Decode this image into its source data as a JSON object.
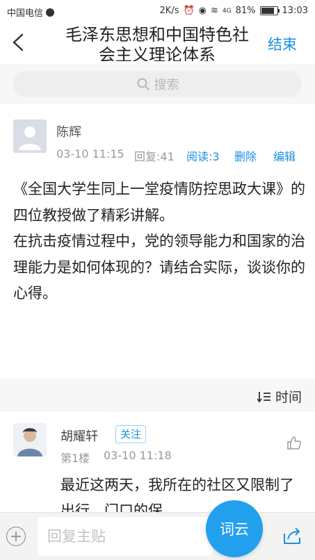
{
  "status_bar": {
    "carrier": "中国电信",
    "speed": "2K/s",
    "signal": "4G",
    "battery": "81%",
    "time": "13:03"
  },
  "header": {
    "title": "毛泽东思想和中国特色社会主义理论体系",
    "end_label": "结束"
  },
  "search": {
    "placeholder": "搜索"
  },
  "post": {
    "author": "陈辉",
    "time": "03-10 11:15",
    "replies": "回复:41",
    "reads": "阅读:3",
    "delete_label": "删除",
    "edit_label": "编辑",
    "body": "《全国大学生同上一堂疫情防控思政大课》的四位教授做了精彩讲解。\n在抗击疫情过程中，党的领导能力和国家的治理能力是如何体现的？请结合实际，谈谈你的心得。"
  },
  "sort": {
    "label": "时间"
  },
  "reply": {
    "name": "胡耀轩",
    "follow_label": "关注",
    "floor": "第1楼",
    "time": "03-10 11:18",
    "text": "最近这两天，我所在的社区又限制了出行，门口的保"
  },
  "bottom_bar": {
    "input_placeholder": "回复主贴",
    "cloud_label": "词云"
  },
  "colors": {
    "accent": "#1a8fe0",
    "cloud_button": "#22a0ee"
  }
}
